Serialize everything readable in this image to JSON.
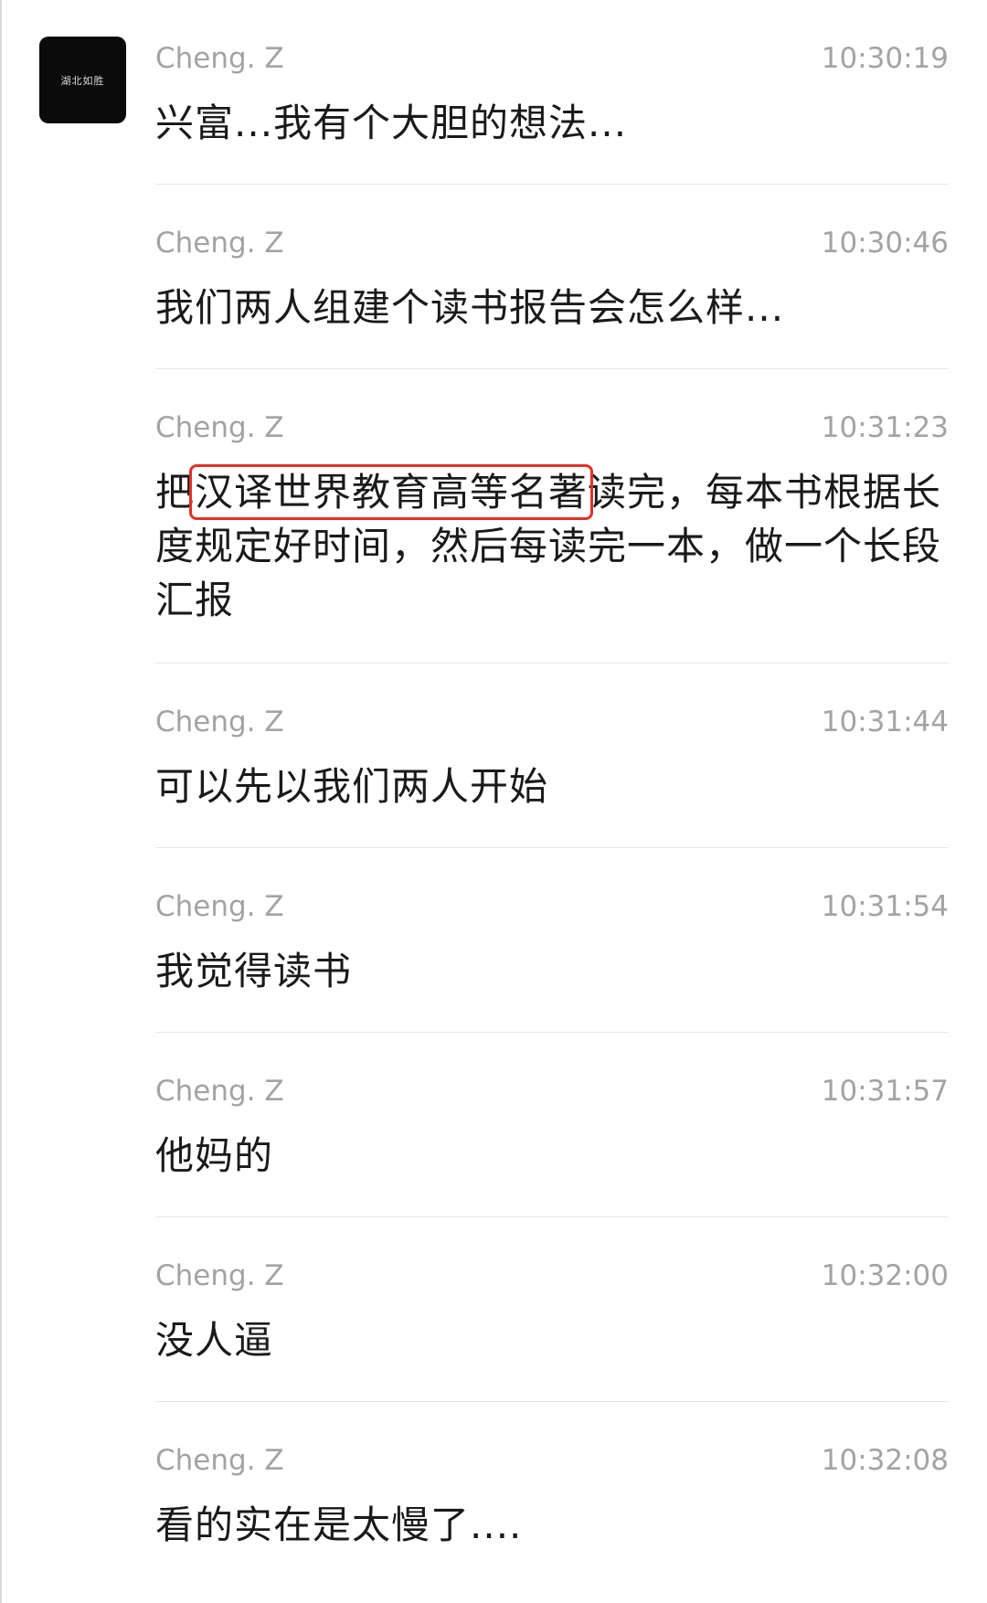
{
  "avatar": {
    "label": "湖北如胜",
    "icon": "group-avatar-icon"
  },
  "messages": [
    {
      "sender": "Cheng. Z",
      "time": "10:30:19",
      "text": "兴富...我有个大胆的想法..."
    },
    {
      "sender": "Cheng. Z",
      "time": "10:30:46",
      "text": "我们两人组建个读书报告会怎么样..."
    },
    {
      "sender": "Cheng. Z",
      "time": "10:31:23",
      "text_before": "把",
      "text_highlight": "汉译世界教育高等名著",
      "text_after": "读完，每本书根据长度规定好时间，然后每读完一本，做一个长段汇报"
    },
    {
      "sender": "Cheng. Z",
      "time": "10:31:44",
      "text": "可以先以我们两人开始"
    },
    {
      "sender": "Cheng. Z",
      "time": "10:31:54",
      "text": "我觉得读书"
    },
    {
      "sender": "Cheng. Z",
      "time": "10:31:57",
      "text": "他妈的"
    },
    {
      "sender": "Cheng. Z",
      "time": "10:32:00",
      "text": "没人逼"
    },
    {
      "sender": "Cheng. Z",
      "time": "10:32:08",
      "text": "看的实在是太慢了...."
    }
  ],
  "colors": {
    "highlight_box": "#e0312a",
    "meta_text": "#a3a3a3",
    "body_text": "#1a1a1a",
    "divider": "#e6e6e6"
  }
}
